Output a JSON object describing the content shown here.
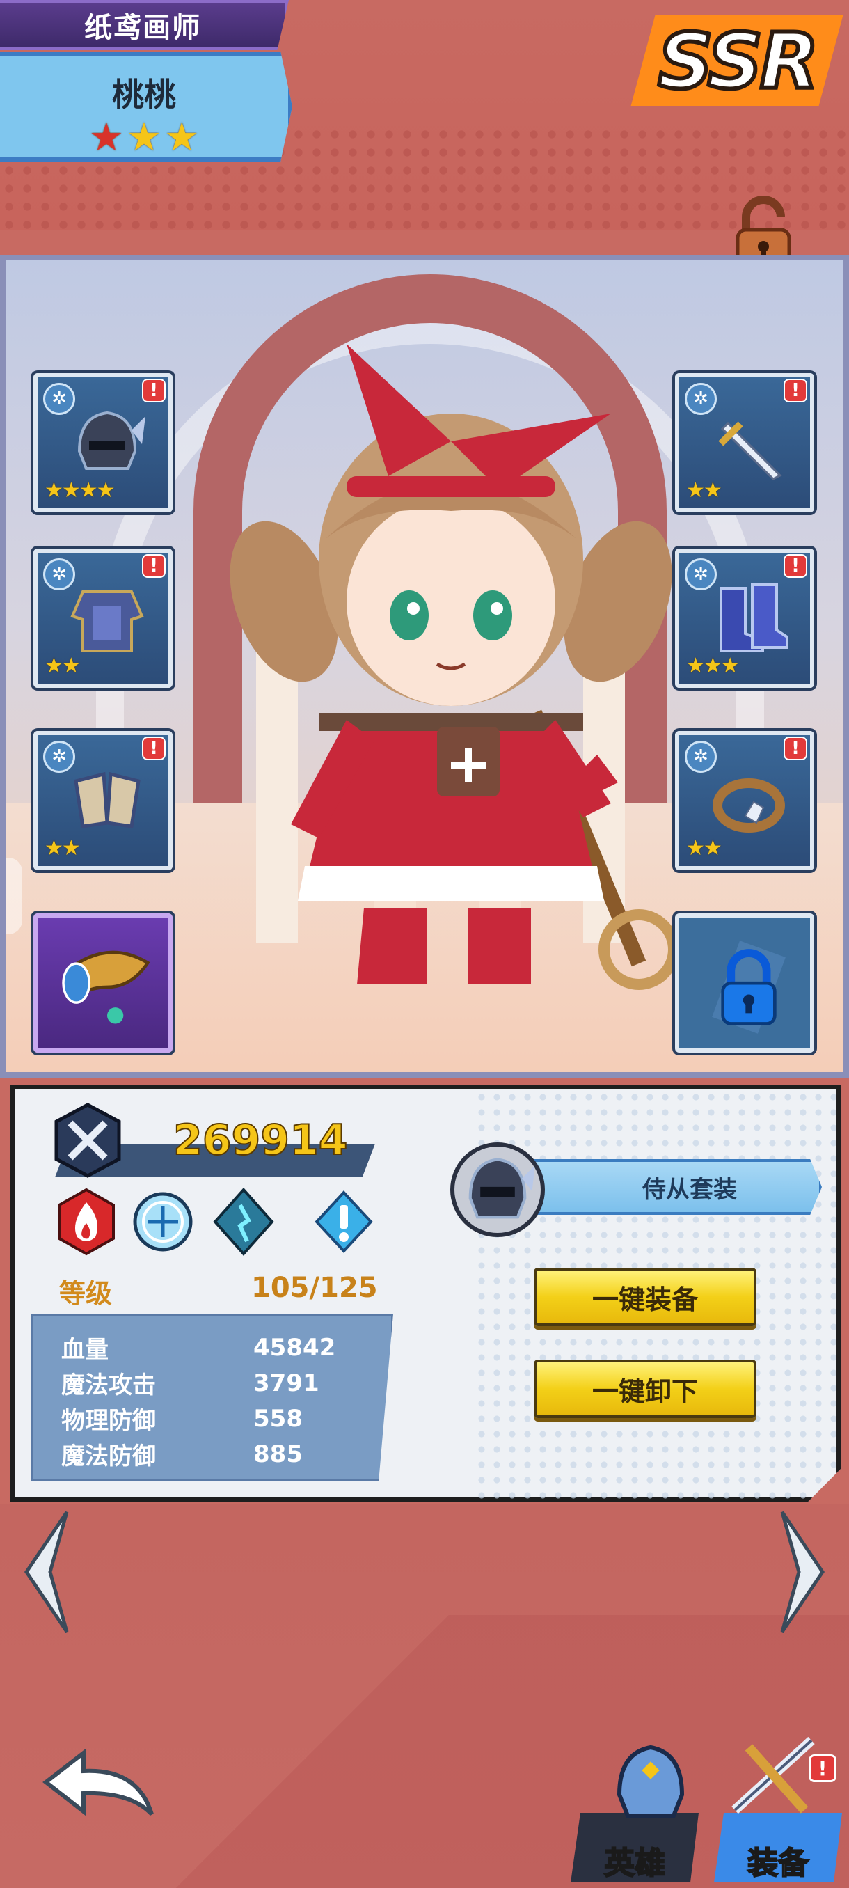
{
  "header": {
    "hero_class": "纸鸢画师",
    "hero_name": "桃桃",
    "rarity": "SSR",
    "star_count": 3
  },
  "equipment": {
    "left_slots": [
      {
        "item": "helmet",
        "stars": "★★★★",
        "alert": "!"
      },
      {
        "item": "armor",
        "stars": "★★",
        "alert": "!"
      },
      {
        "item": "gloves",
        "stars": "★★",
        "alert": "!"
      },
      {
        "item": "horn-accessory",
        "stars": "",
        "alert": ""
      }
    ],
    "right_slots": [
      {
        "item": "sword",
        "stars": "★★",
        "alert": "!"
      },
      {
        "item": "boots",
        "stars": "★★★",
        "alert": "!"
      },
      {
        "item": "ring",
        "stars": "★★",
        "alert": "!"
      },
      {
        "item": "locked",
        "stars": "",
        "alert": ""
      }
    ]
  },
  "info": {
    "power": "269914",
    "elements": [
      "fire-icon",
      "frost-icon",
      "crystal-icon",
      "alert-icon"
    ],
    "level_label": "等级",
    "level_value": "105/125",
    "stats": [
      {
        "label": "血量",
        "value": "45842"
      },
      {
        "label": "魔法攻击",
        "value": "3791"
      },
      {
        "label": "物理防御",
        "value": "558"
      },
      {
        "label": "魔法防御",
        "value": "885"
      }
    ],
    "set_label": "侍从套装",
    "equip_all": "一键装备",
    "unequip_all": "一键卸下"
  },
  "bottom_tabs": [
    {
      "label": "英雄",
      "active": false
    },
    {
      "label": "装备",
      "active": true
    }
  ],
  "colors": {
    "accent_gold": "#f5c518",
    "background": "#c86a62",
    "slot_blue": "#2c4c78"
  }
}
